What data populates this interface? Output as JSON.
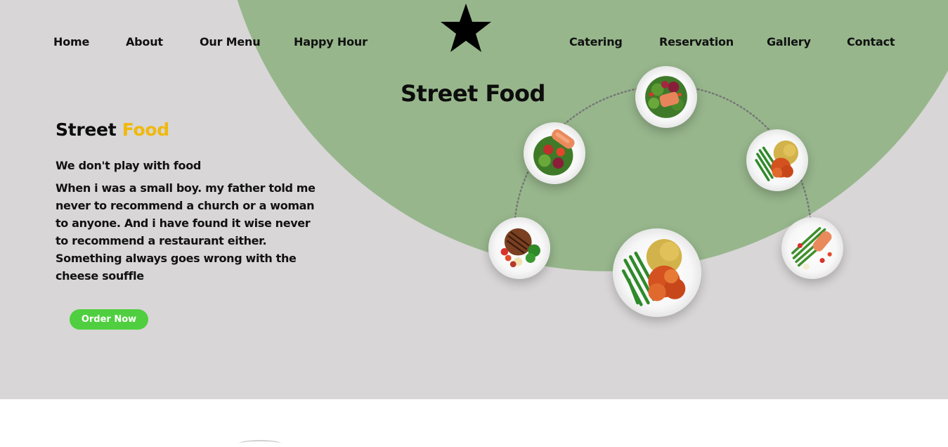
{
  "nav": {
    "left": [
      "Home",
      "About",
      "Our Menu",
      "Happy Hour"
    ],
    "right": [
      "Catering",
      "Reservation",
      "Gallery",
      "Contact"
    ]
  },
  "logo": {
    "icon": "star-icon",
    "color": "#000000"
  },
  "center_title": "Street Food",
  "hero": {
    "heading_word1": "Street",
    "heading_word2": "Food",
    "tagline": "We don't play with food",
    "description_line1": "When i was a small boy. my father told me never to recommend a church or a woman to anyone. And i have found it wise never to recommend a restaurant either.",
    "description_line2": "Something always goes wrong with the cheese souffle",
    "order_button": "Order Now"
  },
  "plates": [
    {
      "name": "salmon-salad-plate-top"
    },
    {
      "name": "salmon-salad-plate-left"
    },
    {
      "name": "chicken-beans-plate-right"
    },
    {
      "name": "steak-vegetables-plate"
    },
    {
      "name": "chicken-beans-rice-plate-large"
    },
    {
      "name": "salmon-asparagus-plate"
    }
  ],
  "colors": {
    "background": "#d8d6d7",
    "green_circle": "#97b68c",
    "accent_yellow": "#f0b90b",
    "button_green": "#4fcf3f",
    "text": "#111111"
  }
}
